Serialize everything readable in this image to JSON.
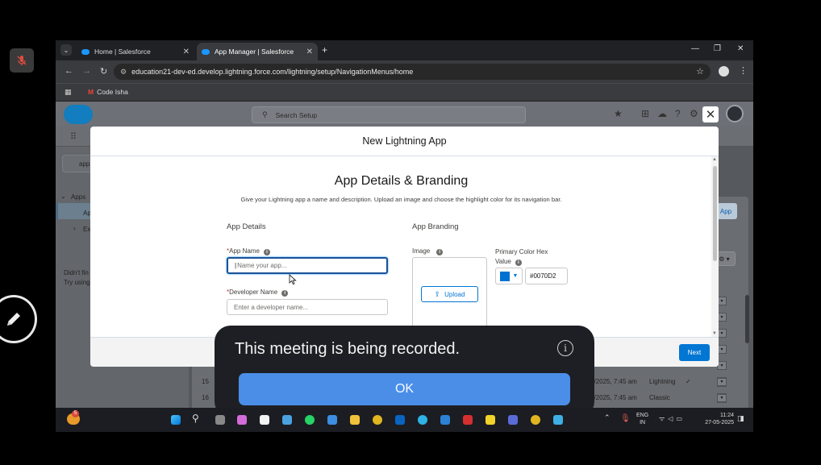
{
  "browser": {
    "tabs": [
      {
        "label": "Home | Salesforce",
        "active": false
      },
      {
        "label": "App Manager | Salesforce",
        "active": true
      }
    ],
    "url": "education21-dev-ed.develop.lightning.force.com/lightning/setup/NavigationMenus/home",
    "bookmarks": [
      {
        "label": "Code Isha"
      }
    ]
  },
  "salesforce": {
    "search_placeholder": "Search Setup",
    "quick_find_value": "app",
    "sidebar": {
      "apps_label": "Apps",
      "app_manager_partial": "Ap",
      "ex_partial": "Ex",
      "didnt_find": "Didn't fin",
      "try_using": "Try using"
    },
    "new_app_button": "App",
    "rows": [
      {
        "num": "15",
        "date": "5/2025, 7:45 am",
        "type": "Lightning",
        "check": "✓"
      },
      {
        "num": "16",
        "date": "5/2025, 7:45 am",
        "type": "Classic",
        "check": ""
      }
    ]
  },
  "modal": {
    "header_title": "New Lightning App",
    "section_title": "App Details & Branding",
    "description": "Give your Lightning app a name and description. Upload an image and choose the highlight color for its navigation bar.",
    "app_details_title": "App Details",
    "app_branding_title": "App Branding",
    "app_name_label": "App Name",
    "app_name_placeholder": "Name your app...",
    "developer_name_label": "Developer Name",
    "developer_name_placeholder": "Enter a developer name...",
    "image_label": "Image",
    "upload_label": "Upload",
    "primary_color_label_line1": "Primary Color Hex",
    "primary_color_label_line2": "Value",
    "primary_color_value": "#0070D2",
    "next_label": "Next"
  },
  "recording_toast": {
    "message": "This meeting is being recorded.",
    "ok_label": "OK"
  },
  "taskbar": {
    "lang_line1": "ENG",
    "lang_line2": "IN",
    "time": "11:24",
    "date": "27-05-2025",
    "weather_badge": "5"
  },
  "colors": {
    "salesforce_blue": "#0176d3",
    "brand_color": "#0070d2",
    "toast_button": "#4a8ee8"
  }
}
